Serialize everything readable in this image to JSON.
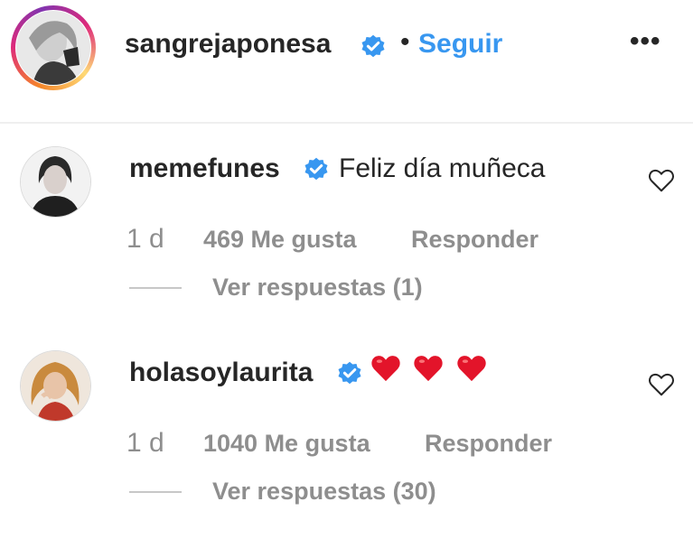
{
  "post": {
    "author": "sangrejaponesa",
    "separator": "•",
    "follow_label": "Seguir",
    "more_label": "•••"
  },
  "comments": [
    {
      "username": "memefunes",
      "text": "Feliz día muñeca",
      "time": "1 d",
      "likes": "469 Me gusta",
      "reply_label": "Responder",
      "view_replies": "Ver respuestas (1)"
    },
    {
      "username": "holasoylaurita",
      "text": "",
      "emoji_hearts": 3,
      "time": "1 d",
      "likes": "1040 Me gusta",
      "reply_label": "Responder",
      "view_replies": "Ver respuestas (30)"
    }
  ],
  "colors": {
    "link_blue": "#3897f0",
    "verified_blue": "#3897f0",
    "muted_gray": "#8e8e8e",
    "heart_red": "#ed4956"
  },
  "icons": {
    "verified": "verified-badge-icon",
    "like": "heart-outline-icon",
    "emoji": "red-heart-emoji-icon"
  }
}
